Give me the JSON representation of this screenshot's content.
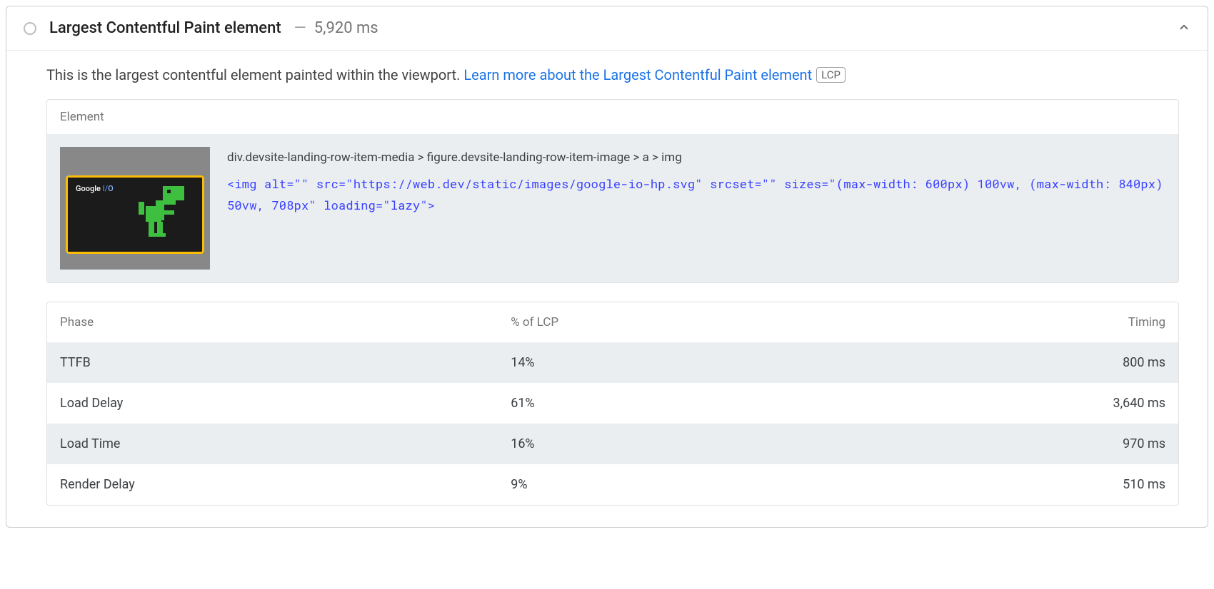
{
  "audit": {
    "title": "Largest Contentful Paint element",
    "value_label": "5,920 ms",
    "description_text": "This is the largest contentful element painted within the viewport. ",
    "learn_more_text": "Learn more about the Largest Contentful Paint element",
    "lcp_badge": "LCP",
    "element_section": {
      "header": "Element",
      "selector_path": "div.devsite-landing-row-item-media > figure.devsite-landing-row-item-image > a > img",
      "snippet": "<img alt=\"\" src=\"https://web.dev/static/images/google-io-hp.svg\" srcset=\"\" sizes=\"(max-width: 600px) 100vw, (max-width: 840px) 50vw, 708px\" loading=\"lazy\">"
    },
    "phase_table": {
      "columns": [
        "Phase",
        "% of LCP",
        "Timing"
      ],
      "rows": [
        {
          "phase": "TTFB",
          "pct": "14%",
          "timing": "800 ms"
        },
        {
          "phase": "Load Delay",
          "pct": "61%",
          "timing": "3,640 ms"
        },
        {
          "phase": "Load Time",
          "pct": "16%",
          "timing": "970 ms"
        },
        {
          "phase": "Render Delay",
          "pct": "9%",
          "timing": "510 ms"
        }
      ]
    }
  }
}
